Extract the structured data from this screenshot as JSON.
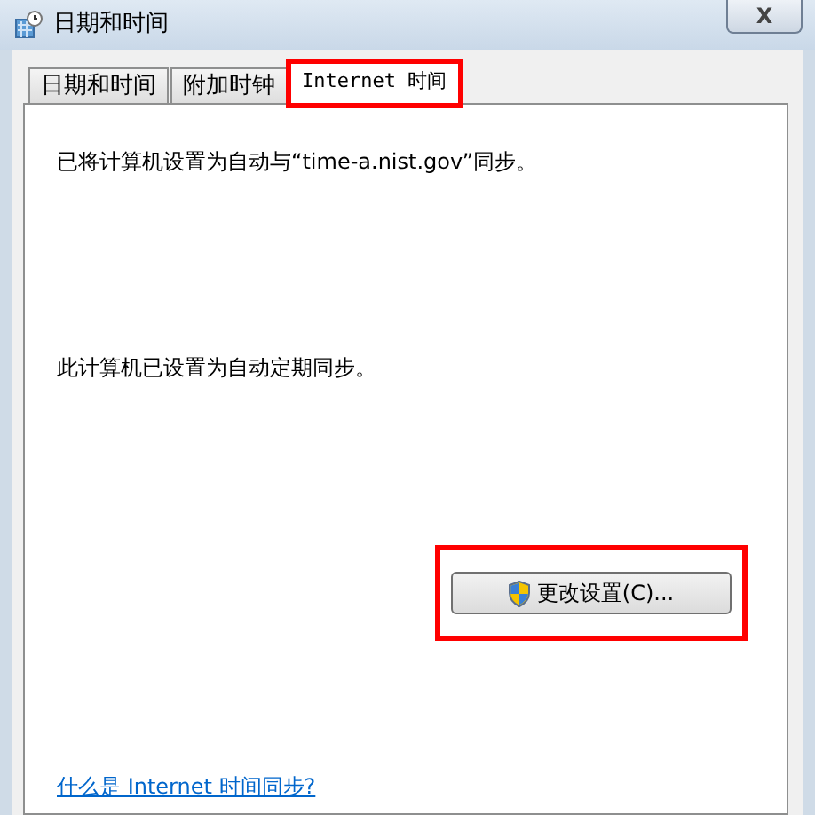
{
  "window": {
    "title": "日期和时间",
    "close_label": "X"
  },
  "tabs": [
    {
      "label": "日期和时间",
      "selected": false,
      "highlighted": false
    },
    {
      "label": "附加时钟",
      "selected": false,
      "highlighted": false
    },
    {
      "label": "Internet 时间",
      "selected": true,
      "highlighted": true
    }
  ],
  "sync_message": "已将计算机设置为自动与“time-a.nist.gov”同步。",
  "schedule_message": "此计算机已设置为自动定期同步。",
  "change_button": {
    "label": "更改设置(C)...",
    "highlighted": true
  },
  "help_link": "什么是 Internet 时间同步?"
}
